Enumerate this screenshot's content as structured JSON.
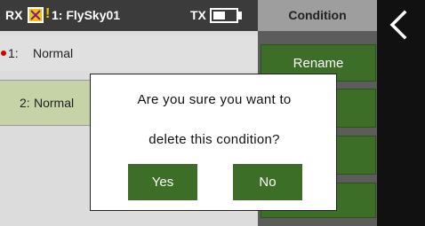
{
  "status_bar": {
    "rx_label": "RX",
    "warning_mark": "!",
    "model_name": "1: FlySky01",
    "tx_label": "TX",
    "tx_battery_level": 0.55,
    "rx_status_color": "#f5c400"
  },
  "page": {
    "title": "Condition"
  },
  "conditions": [
    {
      "number": "1:",
      "name": "Normal",
      "active": true
    },
    {
      "number": "2:",
      "name": "Normal",
      "selected": true
    }
  ],
  "side_buttons": {
    "rename": "Rename",
    "switch": "ch",
    "copy": "py",
    "delete": "e"
  },
  "dialog": {
    "line1": "Are you sure you want to",
    "line2": "delete this condition?",
    "yes": "Yes",
    "no": "No"
  },
  "colors": {
    "accent_green": "#3d6e27",
    "selected_row": "#c5d3a6",
    "active_dot": "#d40000"
  },
  "icons": {
    "back": "chevron-left-icon",
    "rx_status": "x-box-icon",
    "battery": "battery-icon"
  }
}
